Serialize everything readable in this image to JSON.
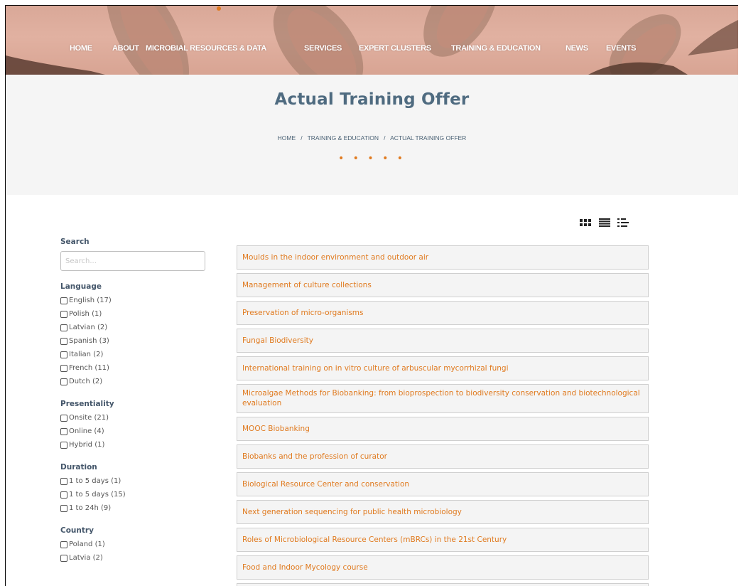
{
  "nav": {
    "items": [
      "HOME",
      "ABOUT",
      "MICROBIAL RESOURCES & DATA",
      "SERVICES",
      "EXPERT CLUSTERS",
      "TRAINING & EDUCATION",
      "NEWS",
      "EVENTS"
    ]
  },
  "page": {
    "title": "Actual Training Offer",
    "breadcrumb": {
      "home": "HOME",
      "sep1": "/",
      "section": "TRAINING & EDUCATION",
      "sep2": "/",
      "current": "ACTUAL TRAINING OFFER"
    },
    "dots": "• • • • •"
  },
  "view_toggle": {
    "icons": [
      "grid-view-icon",
      "list-view-icon",
      "compact-list-view-icon"
    ]
  },
  "sidebar": {
    "search_label": "Search",
    "search_placeholder": "Search...",
    "groups": [
      {
        "heading": "Language",
        "options": [
          "English (17)",
          "Polish (1)",
          "Latvian (2)",
          "Spanish (3)",
          "Italian (2)",
          "French (11)",
          "Dutch (2)"
        ]
      },
      {
        "heading": "Presentiality",
        "options": [
          "Onsite (21)",
          "Online (4)",
          "Hybrid (1)"
        ]
      },
      {
        "heading": "Duration",
        "options": [
          "1 to 5 days (1)",
          "1 to 5 days (15)",
          "1 to 24h (9)"
        ]
      },
      {
        "heading": "Country",
        "options": [
          "Poland (1)",
          "Latvia (2)"
        ]
      }
    ]
  },
  "courses": [
    "Moulds in the indoor environment and outdoor air",
    "Management of culture collections",
    "Preservation of micro-organisms",
    "Fungal Biodiversity",
    "International training on in vitro culture of arbuscular mycorrhizal fungi",
    "Microalgae Methods for Biobanking: from bioprospection to biodiversity conservation and biotechnological evaluation",
    "MOOC Biobanking",
    "Biobanks and the profession of curator",
    "Biological Resource Center and conservation",
    "Next generation sequencing for public health microbiology",
    "Roles of Microbiological Resource Centers (mBRCs) in the 21st Century",
    "Food and Indoor Mycology course"
  ],
  "colors": {
    "accent": "#e07a1f",
    "title": "#4f6b80",
    "banner": "#dba999"
  }
}
